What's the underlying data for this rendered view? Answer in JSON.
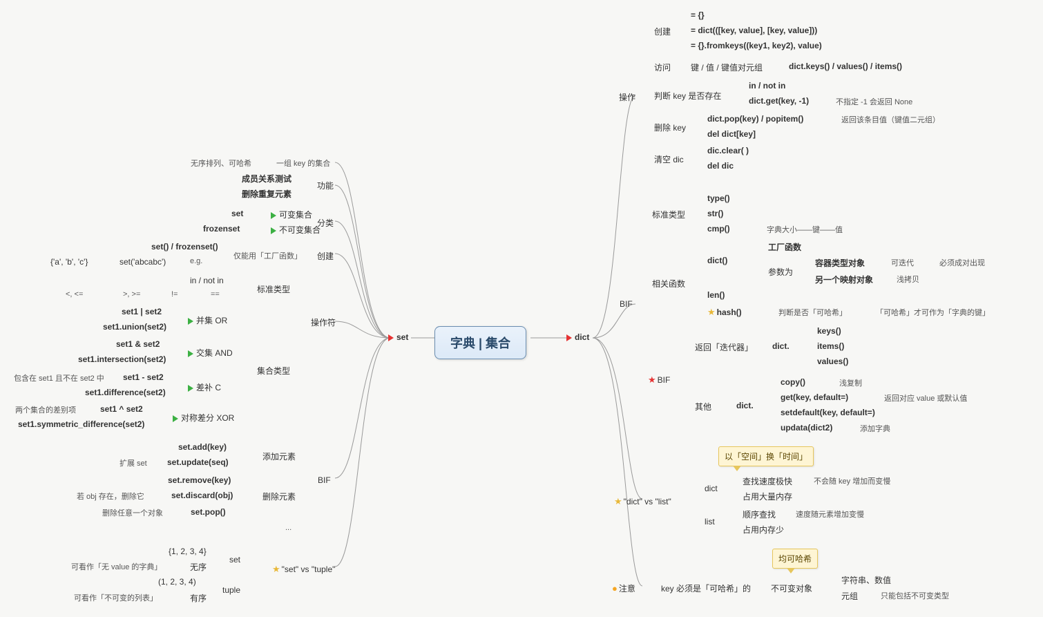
{
  "center": {
    "title": "字典 | 集合"
  },
  "main": {
    "set": "set",
    "dict": "dict"
  },
  "set_branch": {
    "desc": {
      "left": "无序排列、可哈希",
      "right": "一组 key 的集合"
    },
    "func": {
      "label": "功能",
      "a": "成员关系测试",
      "b": "删除重复元素"
    },
    "classify": {
      "label": "分类",
      "set_t": "set",
      "set_note": "可变集合",
      "frozen_t": "frozenset",
      "frozen_note": "不可变集合"
    },
    "create": {
      "label": "创建",
      "note": "仅能用「工厂函数」",
      "m1": "set() / frozenset()",
      "eg_label": "e.g.",
      "eg1": "set('abcabc')",
      "eg2": "{'a', 'b', 'c'}"
    },
    "ops": {
      "label": "操作符",
      "std": {
        "label": "标准类型",
        "a": "in / not in",
        "b1": "<, <=",
        "b2": ">, >=",
        "b3": "!=",
        "b4": "=="
      },
      "settype": {
        "label": "集合类型",
        "union": {
          "label": "并集 OR",
          "a": "set1 | set2",
          "b": "set1.union(set2)"
        },
        "inter": {
          "label": "交集 AND",
          "a": "set1 & set2",
          "b": "set1.intersection(set2)"
        },
        "diff": {
          "label": "差补 C",
          "a": "set1 - set2",
          "b": "set1.difference(set2)",
          "note": "包含在 set1 且不在 set2 中"
        },
        "sym": {
          "label": "对称差分 XOR",
          "a": "set1 ^ set2",
          "b": "set1.symmetric_difference(set2)",
          "note": "两个集合的差别项"
        }
      }
    },
    "bif": {
      "label": "BIF",
      "add": {
        "label": "添加元素",
        "a": "set.add(key)",
        "b": "set.update(seq)",
        "bnote": "扩展 set"
      },
      "del": {
        "label": "删除元素",
        "a": "set.remove(key)",
        "b": "set.discard(obj)",
        "bnote": "若 obj 存在，删除它",
        "c": "set.pop()",
        "cnote": "删除任意一个对象"
      },
      "etc": "..."
    },
    "vs": {
      "label": "\"set\" vs \"tuple\"",
      "set": {
        "label": "set",
        "a": "{1, 2, 3, 4}",
        "b": "无序",
        "bnote": "可看作「无 value 的字典」"
      },
      "tuple": {
        "label": "tuple",
        "a": "(1, 2, 3, 4)",
        "b": "有序",
        "bnote": "可看作「不可变的列表」"
      }
    }
  },
  "dict_branch": {
    "ops": {
      "label": "操作",
      "create": {
        "label": "创建",
        "a": "= {}",
        "b": "= dict(([key, value], [key, value]))",
        "c": "= {}.fromkeys((key1, key2), value)"
      },
      "access": {
        "label": "访问",
        "a": "键 / 值 / 键值对元组",
        "b": "dict.keys() / values() / items()"
      },
      "check": {
        "label": "判断 key 是否存在",
        "a": "in / not in",
        "b": "dict.get(key, -1)",
        "bnote": "不指定 -1 会返回 None"
      },
      "delkey": {
        "label": "删除 key",
        "a": "dict.pop(key) / popitem()",
        "anote": "返回该条目值（键值二元组）",
        "b": "del dict[key]"
      },
      "clear": {
        "label": "清空 dic",
        "a": "dic.clear( )",
        "b": "del dic"
      }
    },
    "bif": {
      "label": "BIF",
      "std": {
        "label": "标准类型",
        "a": "type()",
        "b": "str()",
        "c": "cmp()",
        "cnote": "字典大小——键——值"
      },
      "rel": {
        "label": "相关函数",
        "dict": {
          "label": "dict()",
          "a": "工厂函数",
          "b": "参数为",
          "c1": "容器类型对象",
          "c1n1": "可迭代",
          "c1n2": "必须成对出现",
          "c2": "另一个映射对象",
          "c2n": "浅拷贝"
        },
        "len": "len()",
        "hash": {
          "label": "hash()",
          "a": "判断是否「可哈希」",
          "b": "「可哈希」才可作为「字典的键」"
        }
      },
      "bif2": {
        "label": "BIF",
        "iter": {
          "label": "返回「迭代器」",
          "mid": "dict.",
          "a": "keys()",
          "b": "items()",
          "c": "values()"
        },
        "other": {
          "label": "其他",
          "mid": "dict.",
          "a": "copy()",
          "anote": "浅复制",
          "b": "get(key, default=)",
          "bnote": "返回对应 value 或默认值",
          "c": "setdefault(key, default=)",
          "d": "updata(dict2)",
          "dnote": "添加字典"
        }
      }
    },
    "vs": {
      "label": "\"dict\" vs \"list\"",
      "callout": "以「空间」换「时间」",
      "dict": {
        "label": "dict",
        "a": "查找速度极快",
        "anote": "不会随 key 增加而变慢",
        "b": "占用大量内存"
      },
      "list": {
        "label": "list",
        "a": "顺序查找",
        "anote": "速度随元素增加变慢",
        "b": "占用内存少"
      }
    },
    "note": {
      "label": "注意",
      "a": "key 必须是「可哈希」的",
      "b": "不可变对象",
      "callout": "均可哈希",
      "c1": "字符串、数值",
      "c2": "元组",
      "c2n": "只能包括不可变类型"
    }
  }
}
